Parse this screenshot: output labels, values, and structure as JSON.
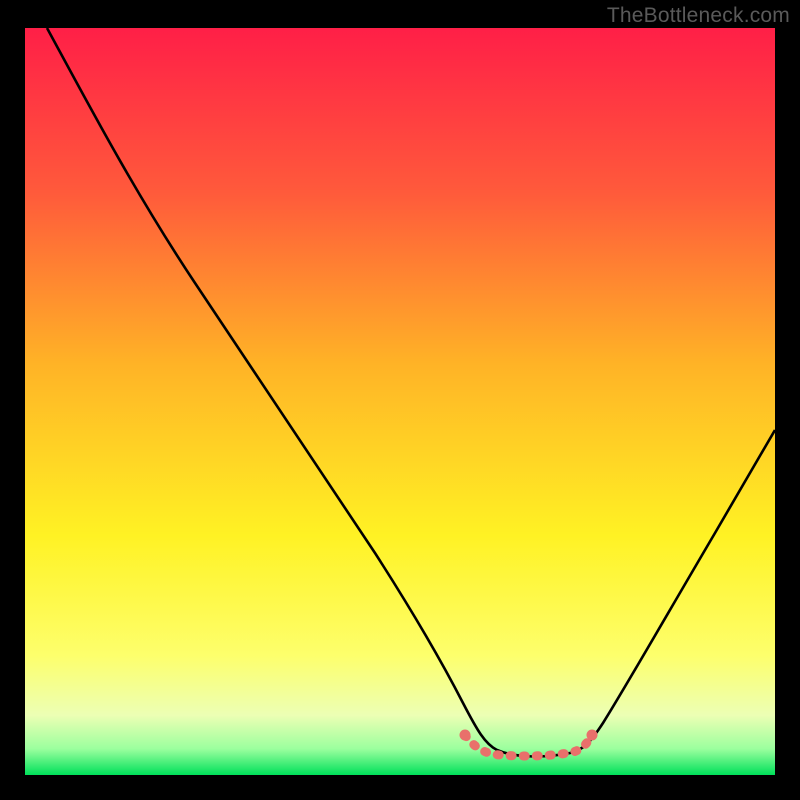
{
  "watermark": "TheBottleneck.com",
  "chart_data": {
    "type": "line",
    "title": "",
    "xlabel": "",
    "ylabel": "",
    "xlim": [
      0,
      100
    ],
    "ylim": [
      0,
      100
    ],
    "background": {
      "type": "vertical-gradient",
      "stops": [
        {
          "pos": 0.0,
          "color": "#ff1f47"
        },
        {
          "pos": 0.22,
          "color": "#ff5a3b"
        },
        {
          "pos": 0.45,
          "color": "#ffb326"
        },
        {
          "pos": 0.68,
          "color": "#fff224"
        },
        {
          "pos": 0.84,
          "color": "#fdff6c"
        },
        {
          "pos": 0.92,
          "color": "#ecffb4"
        },
        {
          "pos": 0.965,
          "color": "#9bff9e"
        },
        {
          "pos": 1.0,
          "color": "#00e05a"
        }
      ]
    },
    "series": [
      {
        "name": "bottleneck-curve",
        "color": "#000000",
        "type": "line",
        "x": [
          3,
          10,
          20,
          30,
          40,
          50,
          55,
          58,
          60,
          62,
          66,
          70,
          73,
          75,
          80,
          85,
          90,
          95,
          100
        ],
        "y": [
          100,
          87,
          72,
          58,
          43,
          28,
          19,
          12,
          8,
          5,
          3,
          3,
          3,
          4,
          11,
          22,
          34,
          47,
          60
        ]
      },
      {
        "name": "optimal-range-marker",
        "color": "#e9706b",
        "type": "line",
        "x": [
          58.5,
          60,
          63,
          66,
          70,
          73,
          74.5
        ],
        "y": [
          4.5,
          3.2,
          2.8,
          2.8,
          2.8,
          3.0,
          4.5
        ]
      }
    ],
    "optimal_range": {
      "x_start": 58.5,
      "x_end": 74.5
    }
  }
}
